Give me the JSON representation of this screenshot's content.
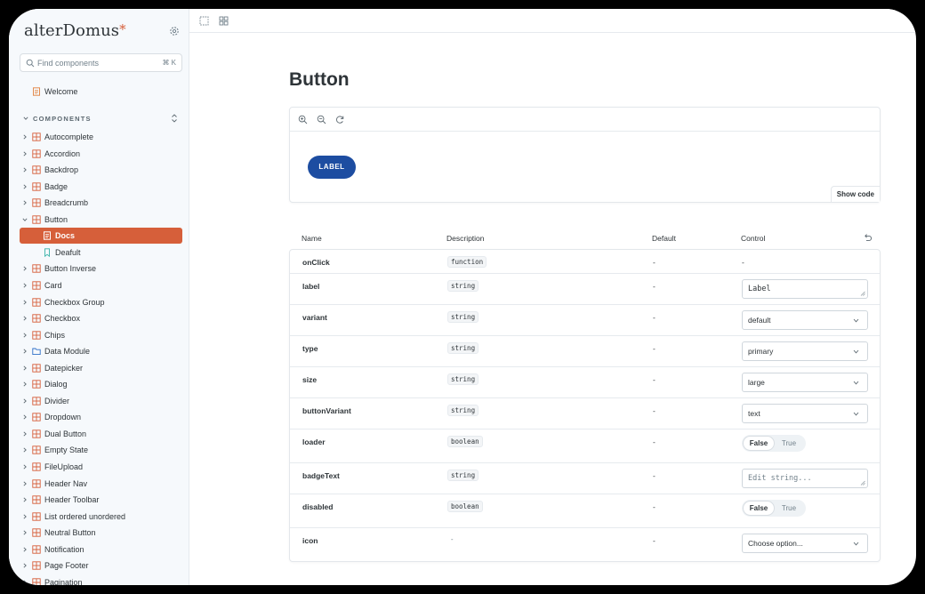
{
  "app": {
    "brand_name": "alterDomus",
    "brand_mark": "*",
    "accent_color": "#d65f3a",
    "primary_button_color": "#1d4da1"
  },
  "sidebar": {
    "search": {
      "placeholder": "Find components",
      "shortcut": "⌘ K"
    },
    "welcome_label": "Welcome",
    "section_title": "COMPONENTS",
    "items": [
      {
        "label": "Autocomplete"
      },
      {
        "label": "Accordion"
      },
      {
        "label": "Backdrop"
      },
      {
        "label": "Badge"
      },
      {
        "label": "Breadcrumb"
      },
      {
        "label": "Button",
        "expanded": true
      },
      {
        "label": "Docs",
        "active": true
      },
      {
        "label": "Deafult"
      },
      {
        "label": "Button Inverse"
      },
      {
        "label": "Card"
      },
      {
        "label": "Checkbox Group"
      },
      {
        "label": "Checkbox"
      },
      {
        "label": "Chips"
      },
      {
        "label": "Data Module",
        "folder": true
      },
      {
        "label": "Datepicker"
      },
      {
        "label": "Dialog"
      },
      {
        "label": "Divider"
      },
      {
        "label": "Dropdown"
      },
      {
        "label": "Dual Button"
      },
      {
        "label": "Empty State"
      },
      {
        "label": "FileUpload"
      },
      {
        "label": "Header Nav"
      },
      {
        "label": "Header Toolbar"
      },
      {
        "label": "List ordered unordered"
      },
      {
        "label": "Neutral Button"
      },
      {
        "label": "Notification"
      },
      {
        "label": "Page Footer"
      },
      {
        "label": "Pagination"
      }
    ]
  },
  "main": {
    "title": "Button",
    "preview": {
      "button_label": "LABEL",
      "show_code_label": "Show code"
    },
    "args_table": {
      "headers": {
        "name": "Name",
        "description": "Description",
        "default": "Default",
        "control": "Control"
      },
      "rows": [
        {
          "name": "onClick",
          "type": "function",
          "default": "-",
          "control_kind": "none",
          "control_value": "-"
        },
        {
          "name": "label",
          "type": "string",
          "default": "-",
          "control_kind": "text",
          "control_value": "Label"
        },
        {
          "name": "variant",
          "type": "string",
          "default": "-",
          "control_kind": "select",
          "control_value": "default"
        },
        {
          "name": "type",
          "type": "string",
          "default": "-",
          "control_kind": "select",
          "control_value": "primary"
        },
        {
          "name": "size",
          "type": "string",
          "default": "-",
          "control_kind": "select",
          "control_value": "large"
        },
        {
          "name": "buttonVariant",
          "type": "string",
          "default": "-",
          "control_kind": "select",
          "control_value": "text"
        },
        {
          "name": "loader",
          "type": "boolean",
          "default": "-",
          "control_kind": "toggle",
          "toggle_false": "False",
          "toggle_true": "True"
        },
        {
          "name": "badgeText",
          "type": "string",
          "default": "-",
          "control_kind": "text-placeholder",
          "control_value": "Edit string..."
        },
        {
          "name": "disabled",
          "type": "boolean",
          "default": "-",
          "control_kind": "toggle",
          "toggle_false": "False",
          "toggle_true": "True"
        },
        {
          "name": "icon",
          "type": "-",
          "default": "-",
          "control_kind": "select",
          "control_value": "Choose option..."
        }
      ]
    }
  }
}
